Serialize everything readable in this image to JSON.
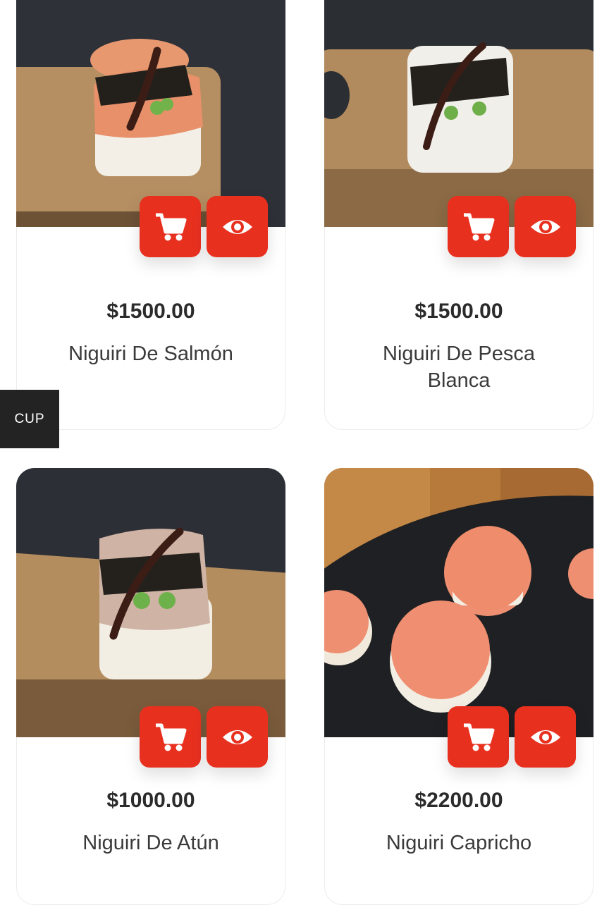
{
  "products": [
    {
      "price": "$1500.00",
      "name": "Niguiri De Salmón",
      "cart_icon": "cart-icon",
      "view_icon": "eye-icon"
    },
    {
      "price": "$1500.00",
      "name": "Niguiri De Pesca Blanca",
      "cart_icon": "cart-icon",
      "view_icon": "eye-icon"
    },
    {
      "price": "$1000.00",
      "name": "Niguiri De Atún",
      "cart_icon": "cart-icon",
      "view_icon": "eye-icon"
    },
    {
      "price": "$2200.00",
      "name": "Niguiri Capricho",
      "cart_icon": "cart-icon",
      "view_icon": "eye-icon"
    }
  ],
  "currency_switch": {
    "label": "CUP"
  },
  "colors": {
    "accent": "#e8301f",
    "text": "#2b2b2b",
    "currency_bg": "#232323"
  }
}
